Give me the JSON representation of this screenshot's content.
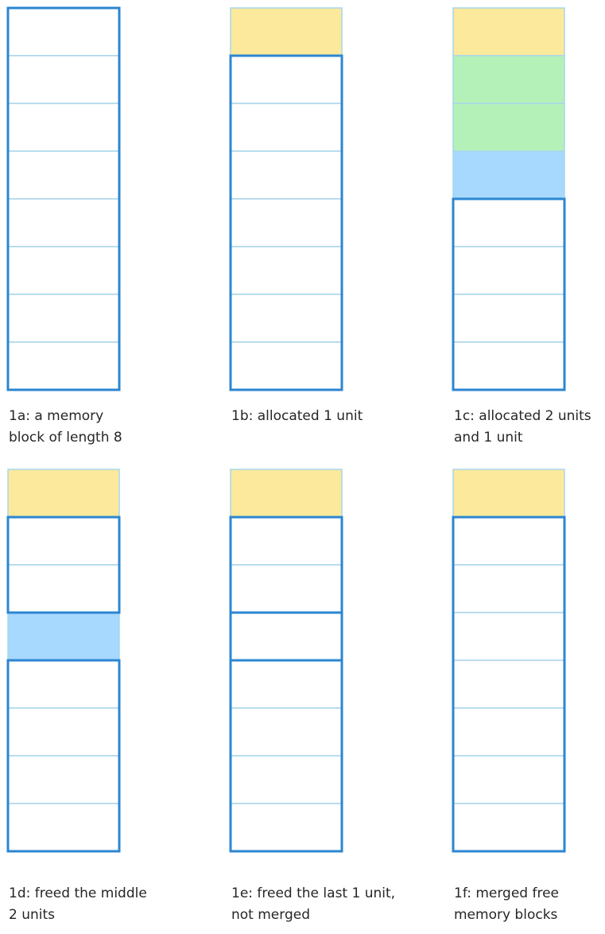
{
  "colors": {
    "free_border": "#2b86d2",
    "unit_divider": "#a8d5ea",
    "free_fill": "#ffffff",
    "yellow_alloc": "#fde99b",
    "green_alloc": "#b4f1b9",
    "blue_alloc": "#a7d8fd"
  },
  "panels": [
    {
      "caption": "1a: a memory\nblock of length 8",
      "units": [
        "free",
        "free",
        "free",
        "free",
        "free",
        "free",
        "free",
        "free"
      ],
      "free_blocks": [
        [
          0,
          8
        ]
      ]
    },
    {
      "caption": "1b: allocated 1 unit",
      "units": [
        "yellow",
        "free",
        "free",
        "free",
        "free",
        "free",
        "free",
        "free"
      ],
      "free_blocks": [
        [
          1,
          8
        ]
      ]
    },
    {
      "caption": "1c: allocated 2 units\nand 1 unit",
      "units": [
        "yellow",
        "green",
        "green",
        "blue",
        "free",
        "free",
        "free",
        "free"
      ],
      "free_blocks": [
        [
          4,
          8
        ]
      ]
    },
    {
      "caption": "1d: freed the middle\n2 units",
      "units": [
        "yellow",
        "free",
        "free",
        "blue",
        "free",
        "free",
        "free",
        "free"
      ],
      "free_blocks": [
        [
          1,
          3
        ],
        [
          4,
          8
        ]
      ]
    },
    {
      "caption": "1e: freed the last 1 unit,\nnot merged",
      "units": [
        "yellow",
        "free",
        "free",
        "free",
        "free",
        "free",
        "free",
        "free"
      ],
      "free_blocks": [
        [
          1,
          3
        ],
        [
          3,
          4
        ],
        [
          4,
          8
        ]
      ]
    },
    {
      "caption": "1f: merged free\nmemory blocks",
      "units": [
        "yellow",
        "free",
        "free",
        "free",
        "free",
        "free",
        "free",
        "free"
      ],
      "free_blocks": [
        [
          1,
          8
        ]
      ]
    }
  ]
}
